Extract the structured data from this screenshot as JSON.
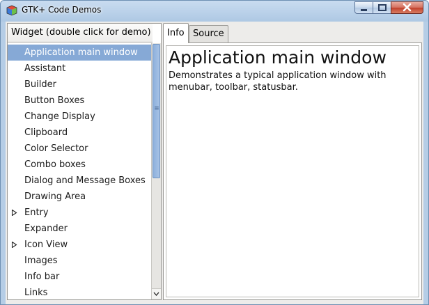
{
  "window": {
    "title": "GTK+ Code Demos",
    "controls": {
      "minimize_icon": "minimize-icon",
      "maximize_icon": "maximize-icon",
      "close_icon": "close-icon"
    },
    "accent_color": "#86a9d6"
  },
  "tree": {
    "header": "Widget (double click for demo)",
    "items": [
      {
        "label": "Application main window",
        "selected": true,
        "expandable": false
      },
      {
        "label": "Assistant",
        "selected": false,
        "expandable": false
      },
      {
        "label": "Builder",
        "selected": false,
        "expandable": false
      },
      {
        "label": "Button Boxes",
        "selected": false,
        "expandable": false
      },
      {
        "label": "Change Display",
        "selected": false,
        "expandable": false
      },
      {
        "label": "Clipboard",
        "selected": false,
        "expandable": false
      },
      {
        "label": "Color Selector",
        "selected": false,
        "expandable": false
      },
      {
        "label": "Combo boxes",
        "selected": false,
        "expandable": false
      },
      {
        "label": "Dialog and Message Boxes",
        "selected": false,
        "expandable": false
      },
      {
        "label": "Drawing Area",
        "selected": false,
        "expandable": false
      },
      {
        "label": "Entry",
        "selected": false,
        "expandable": true
      },
      {
        "label": "Expander",
        "selected": false,
        "expandable": false
      },
      {
        "label": "Icon View",
        "selected": false,
        "expandable": true
      },
      {
        "label": "Images",
        "selected": false,
        "expandable": false
      },
      {
        "label": "Info bar",
        "selected": false,
        "expandable": false
      },
      {
        "label": "Links",
        "selected": false,
        "expandable": false
      }
    ]
  },
  "notebook": {
    "tabs": [
      {
        "label": "Info",
        "active": true
      },
      {
        "label": "Source",
        "active": false
      }
    ],
    "info": {
      "title": "Application main window",
      "description": "Demonstrates a typical application window with menubar, toolbar, statusbar."
    }
  }
}
